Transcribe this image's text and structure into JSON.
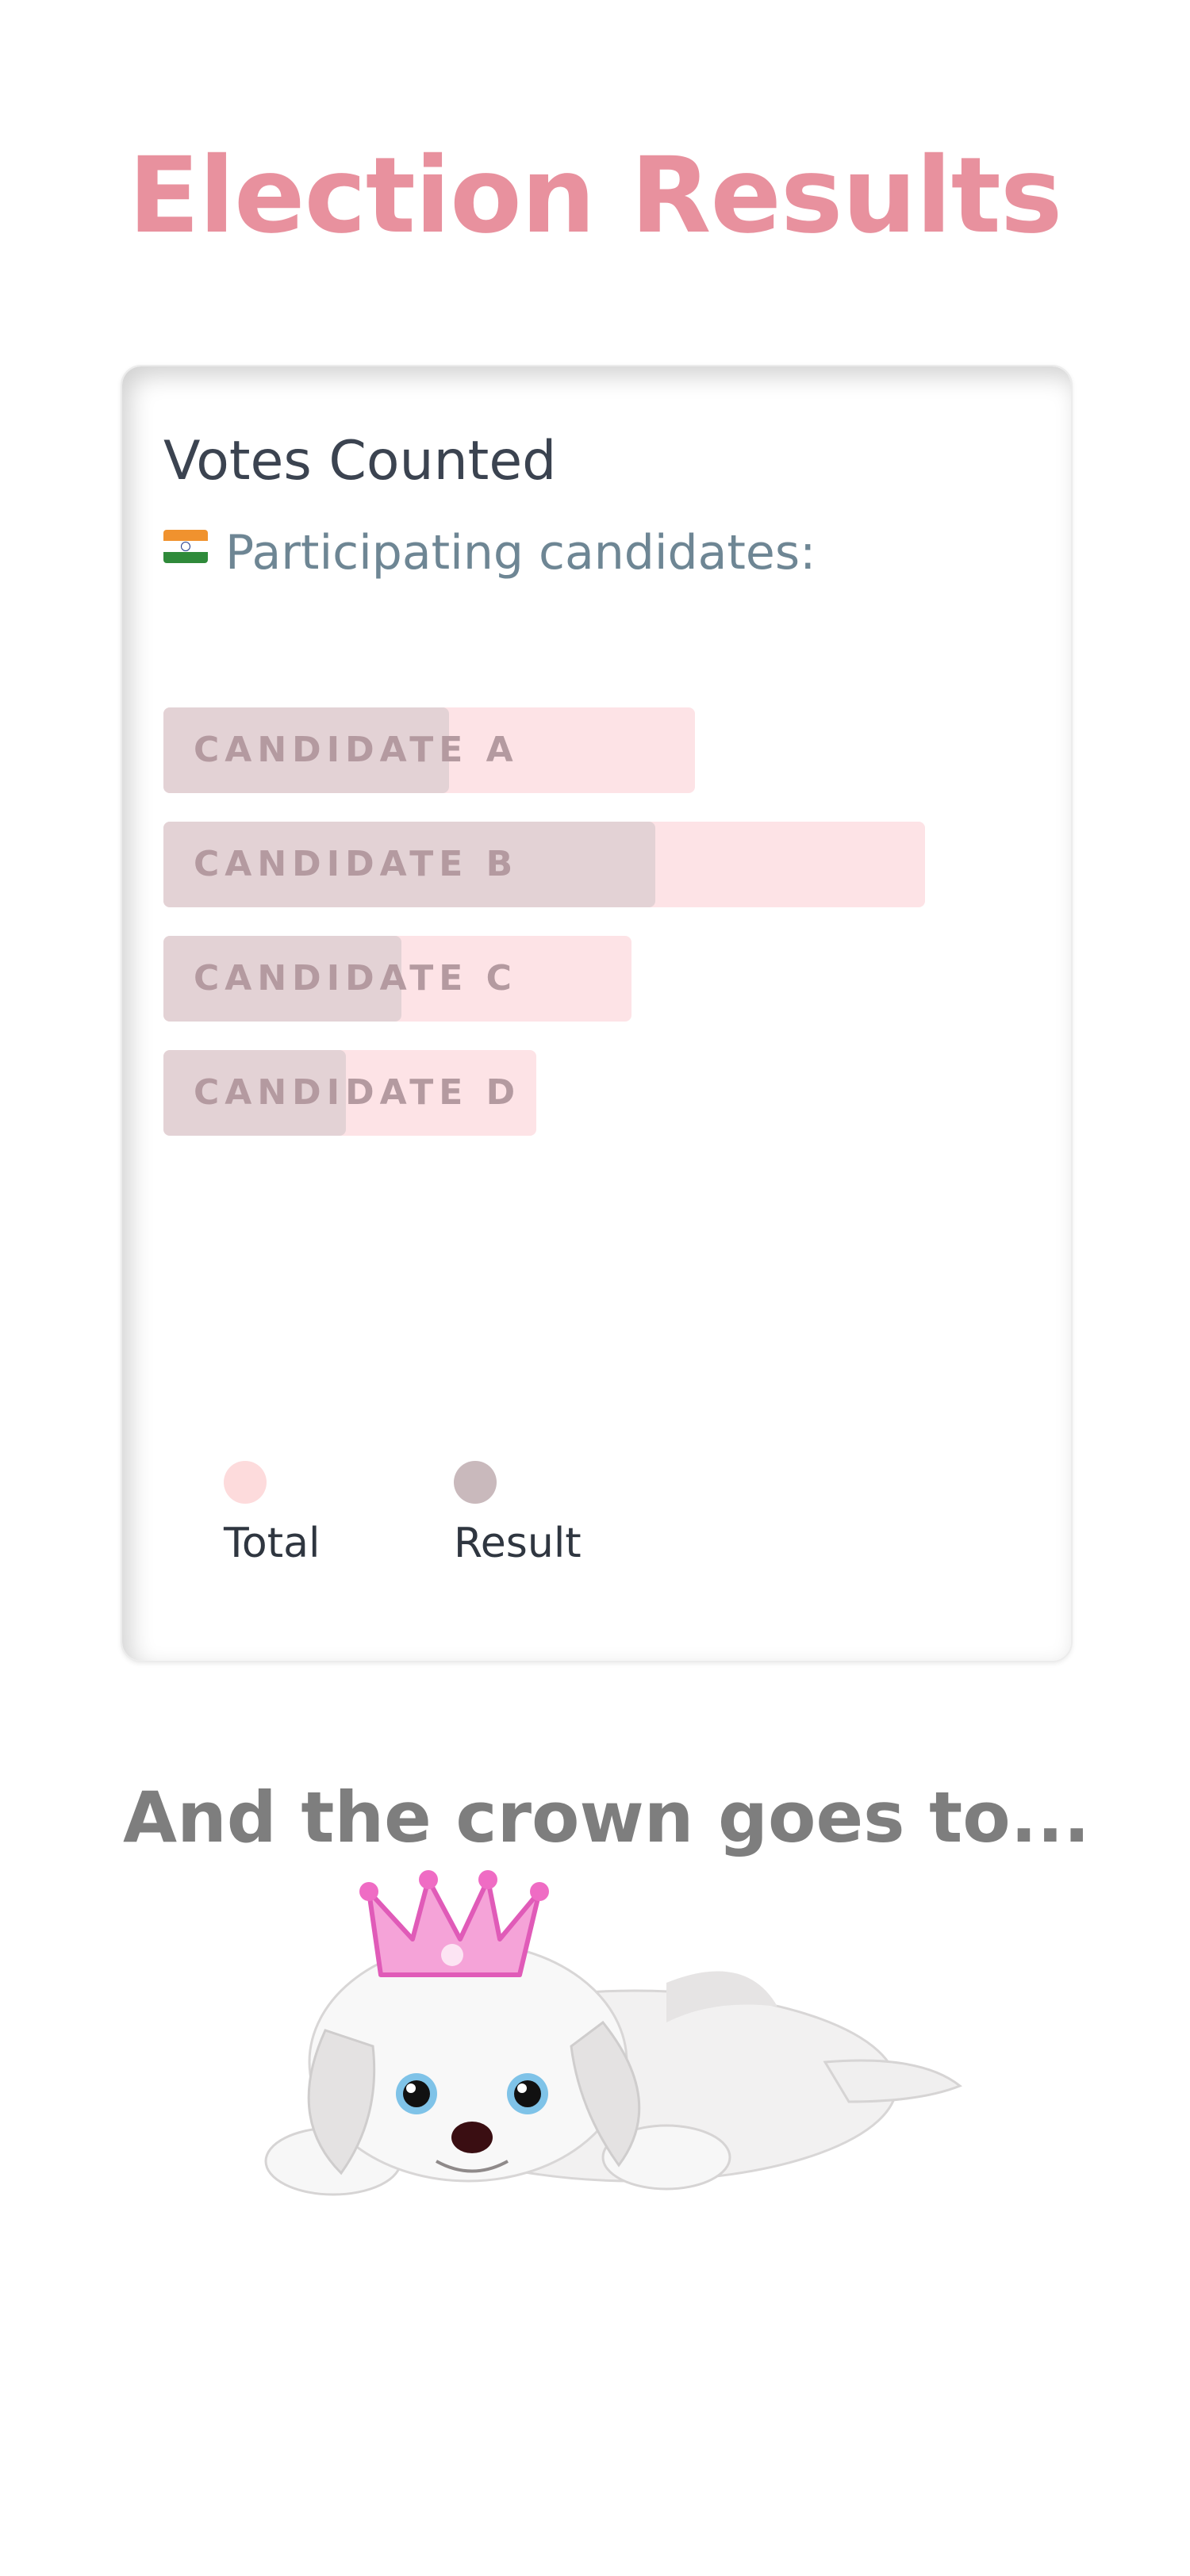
{
  "page": {
    "title": "Election Results"
  },
  "card": {
    "title": "Votes Counted",
    "subtitle": "Participating candidates:",
    "flag_icon": "india-flag-icon"
  },
  "colors": {
    "title": "#e8919e",
    "total": "#fde3e6",
    "result": "#e3d2d5",
    "legend_total": "#fddbdc",
    "legend_result": "#c9b9bc"
  },
  "chart_data": {
    "type": "bar",
    "orientation": "horizontal",
    "categories": [
      "CANDIDATE A",
      "CANDIDATE B",
      "CANDIDATE C",
      "CANDIDATE D"
    ],
    "series": [
      {
        "name": "Total",
        "values": [
          67,
          96,
          59,
          47
        ]
      },
      {
        "name": "Result",
        "values": [
          36,
          62,
          30,
          23
        ]
      }
    ],
    "xlim": [
      0,
      100
    ],
    "grid": false,
    "legend": "bottom-left"
  },
  "legend": {
    "total_label": "Total",
    "result_label": "Result"
  },
  "crown_section": {
    "heading": "And the crown goes to...",
    "image": "puppy-with-crown"
  }
}
